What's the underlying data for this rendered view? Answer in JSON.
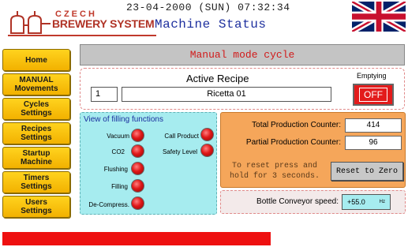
{
  "header": {
    "datetime": "23-04-2000 (SUN) 07:32:34",
    "title": "Machine Status",
    "logo_top": "CZECH",
    "logo_bottom": "BREWERY SYSTEM"
  },
  "sidebar": {
    "items": [
      {
        "label": "Home"
      },
      {
        "label": "MANUAL\nMovements"
      },
      {
        "label": "Cycles\nSettings"
      },
      {
        "label": "Recipes\nSettings"
      },
      {
        "label": "Startup\nMachine"
      },
      {
        "label": "Timers\nSettings"
      },
      {
        "label": "Users\nSettings"
      }
    ]
  },
  "mode": {
    "text": "Manual mode cycle"
  },
  "recipe": {
    "title": "Active Recipe",
    "number": "1",
    "name": "Ricetta 01",
    "emptying_label": "Emptying",
    "emptying_state": "OFF"
  },
  "filling": {
    "title": "View of filling functions",
    "left": [
      "Vacuum",
      "CO2",
      "Flushing",
      "Filling",
      "De-Compress."
    ],
    "right": [
      "Call Product",
      "Safety Level"
    ]
  },
  "counters": {
    "total_label": "Total  Production Counter:",
    "total_value": "414",
    "partial_label": "Partial Production Counter:",
    "partial_value": "96",
    "reset_hint": "To reset press and hold for 3 seconds.",
    "reset_button": "Reset to Zero"
  },
  "conveyor": {
    "label": "Bottle Conveyor speed:",
    "value": "+55.0",
    "unit": "Hz"
  },
  "colors": {
    "accent_yellow": "#f2b100",
    "alarm_red": "#e31b1b",
    "panel_cyan": "#a6ecef",
    "panel_orange": "#f5a65a",
    "title_blue": "#1d2f9e"
  }
}
